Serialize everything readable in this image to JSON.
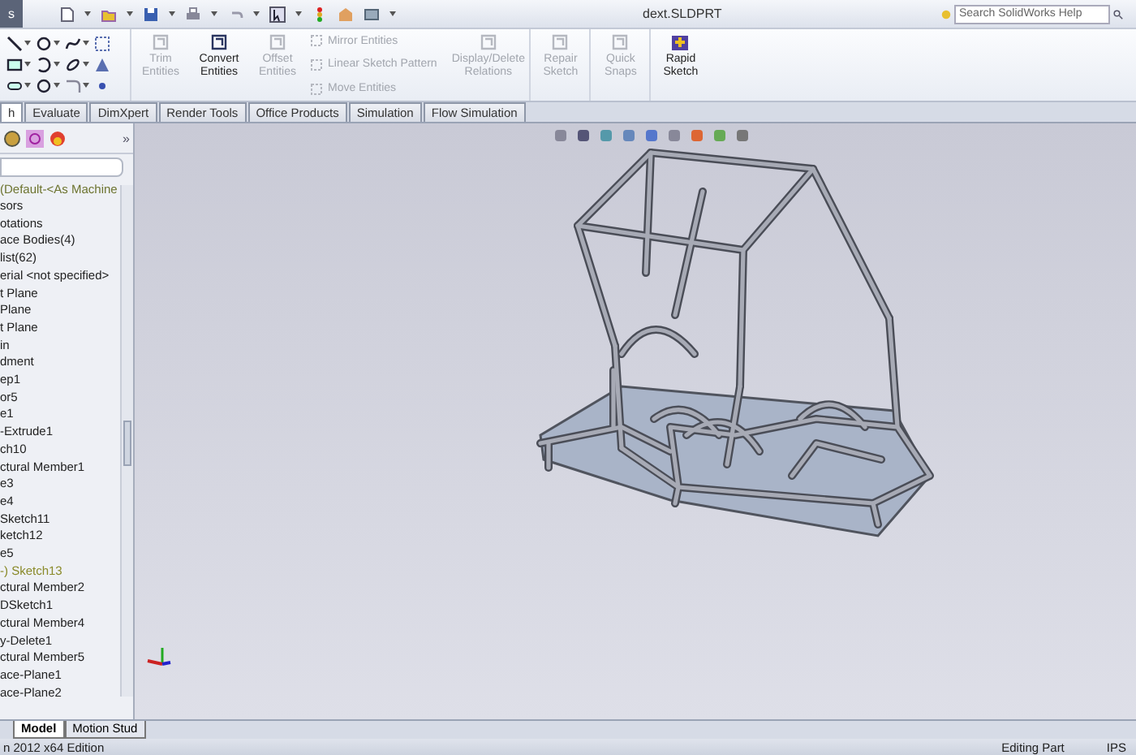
{
  "window": {
    "title": "dext.SLDPRT",
    "corner_tab": "s"
  },
  "search": {
    "placeholder": "Search SolidWorks Help"
  },
  "ribbon": {
    "tools": [
      {
        "kind": "big",
        "label": "Trim Entities",
        "disabled": true
      },
      {
        "kind": "big",
        "label": "Convert Entities",
        "disabled": false
      },
      {
        "kind": "big",
        "label": "Offset Entities",
        "disabled": true
      },
      {
        "kind": "stack",
        "items": [
          {
            "label": "Mirror Entities",
            "disabled": true
          },
          {
            "label": "Linear Sketch Pattern",
            "disabled": true
          },
          {
            "label": "Move Entities",
            "disabled": true
          }
        ]
      },
      {
        "kind": "big",
        "label": "Display/Delete Relations",
        "disabled": true
      },
      {
        "kind": "big",
        "label": "Repair Sketch",
        "disabled": true
      },
      {
        "kind": "big",
        "label": "Quick Snaps",
        "disabled": true
      },
      {
        "kind": "big",
        "label": "Rapid Sketch",
        "disabled": false
      }
    ]
  },
  "tabs": [
    {
      "label": "h",
      "selected": true
    },
    {
      "label": "Evaluate",
      "selected": false
    },
    {
      "label": "DimXpert",
      "selected": false
    },
    {
      "label": "Render Tools",
      "selected": false
    },
    {
      "label": "Office Products",
      "selected": false
    },
    {
      "label": "Simulation",
      "selected": false
    },
    {
      "label": "Flow Simulation",
      "selected": false
    }
  ],
  "panel": {
    "more": "»",
    "config": "(Default-<As Machine",
    "tree": [
      {
        "label": "sors",
        "highlighted": false
      },
      {
        "label": "otations",
        "highlighted": false
      },
      {
        "label": "ace Bodies(4)",
        "highlighted": false
      },
      {
        "label": "list(62)",
        "highlighted": false
      },
      {
        "label": "erial <not specified>",
        "highlighted": false
      },
      {
        "label": "t Plane",
        "highlighted": false
      },
      {
        "label": "Plane",
        "highlighted": false
      },
      {
        "label": "t Plane",
        "highlighted": false
      },
      {
        "label": "in",
        "highlighted": false
      },
      {
        "label": "dment",
        "highlighted": false
      },
      {
        "label": "ep1",
        "highlighted": false
      },
      {
        "label": "or5",
        "highlighted": false
      },
      {
        "label": "e1",
        "highlighted": false
      },
      {
        "label": "-Extrude1",
        "highlighted": false
      },
      {
        "label": "ch10",
        "highlighted": false
      },
      {
        "label": "ctural Member1",
        "highlighted": false
      },
      {
        "label": "e3",
        "highlighted": false
      },
      {
        "label": "e4",
        "highlighted": false
      },
      {
        "label": "Sketch11",
        "highlighted": false
      },
      {
        "label": "ketch12",
        "highlighted": false
      },
      {
        "label": "e5",
        "highlighted": false
      },
      {
        "label": "-) Sketch13",
        "highlighted": true
      },
      {
        "label": "ctural Member2",
        "highlighted": false
      },
      {
        "label": "DSketch1",
        "highlighted": false
      },
      {
        "label": "ctural Member4",
        "highlighted": false
      },
      {
        "label": "y-Delete1",
        "highlighted": false
      },
      {
        "label": "ctural Member5",
        "highlighted": false
      },
      {
        "label": "ace-Plane1",
        "highlighted": false
      },
      {
        "label": "ace-Plane2",
        "highlighted": false
      }
    ]
  },
  "bottom_tabs": [
    {
      "label": "Model",
      "selected": true
    },
    {
      "label": "Motion Stud",
      "selected": false
    }
  ],
  "status_bar": {
    "left": "n 2012 x64 Edition",
    "mode": "Editing Part",
    "units": "IPS"
  }
}
